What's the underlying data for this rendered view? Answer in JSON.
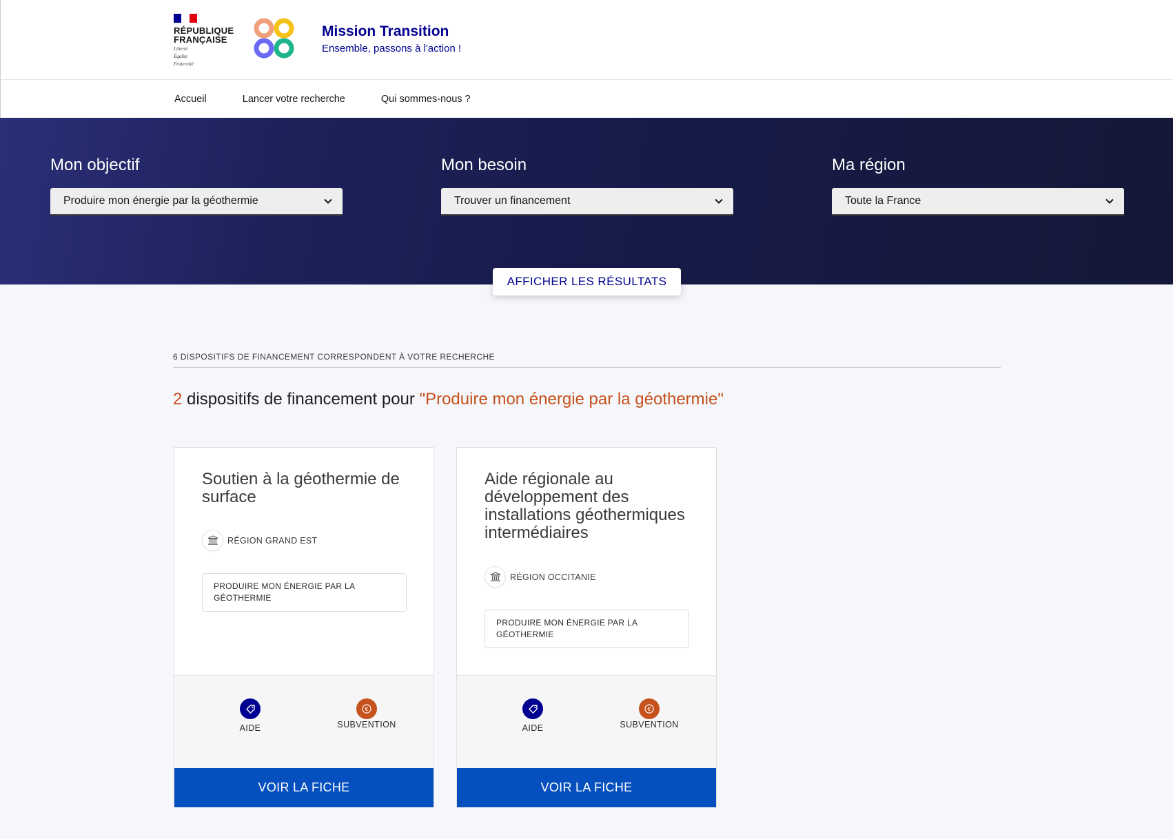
{
  "header": {
    "republic_line1": "RÉPUBLIQUE",
    "republic_line2": "FRANÇAISE",
    "devise1": "Liberté",
    "devise2": "Égalité",
    "devise3": "Fraternité",
    "brand_title": "Mission Transition",
    "brand_tagline": "Ensemble, passons à l'action !",
    "flag_colors": [
      "#000091",
      "#ffffff",
      "#e1000f"
    ],
    "logo_colors": [
      "#f0a07a",
      "#f5c218",
      "#6a6af4",
      "#1fb48a"
    ]
  },
  "nav": {
    "items": [
      {
        "label": "Accueil"
      },
      {
        "label": "Lancer votre recherche"
      },
      {
        "label": "Qui sommes-nous ?"
      }
    ]
  },
  "filters": [
    {
      "label": "Mon objectif",
      "value": "Produire mon énergie par la géothermie"
    },
    {
      "label": "Mon besoin",
      "value": "Trouver un financement"
    },
    {
      "label": "Ma région",
      "value": "Toute la France"
    }
  ],
  "show_results_label": "AFFICHER LES RÉSULTATS",
  "results": {
    "count_line": "6 DISPOSITIFS DE FINANCEMENT CORRESPONDENT À VOTRE RECHERCHE",
    "title_count": "2",
    "title_text": " dispositifs de financement pour ",
    "title_query": "\"Produire mon énergie par la géothermie\""
  },
  "cards": [
    {
      "title": "Soutien à la géothermie de surface",
      "region": "RÉGION GRAND EST",
      "tag": "PRODUIRE MON ÉNERGIE PAR LA GÉOTHERMIE",
      "badge1": "AIDE",
      "badge2": "SUBVENTION",
      "button": "VOIR LA FICHE"
    },
    {
      "title": "Aide régionale au développement des installations géothermiques intermédiaires",
      "region": "RÉGION OCCITANIE",
      "tag": "PRODUIRE MON ÉNERGIE PAR LA GÉOTHERMIE",
      "badge1": "AIDE",
      "badge2": "SUBVENTION",
      "button": "VOIR LA FICHE"
    }
  ],
  "colors": {
    "primary_blue": "#000091",
    "button_blue": "#0550be",
    "accent_orange": "#c5511c",
    "hero_dark": "#171b49"
  }
}
